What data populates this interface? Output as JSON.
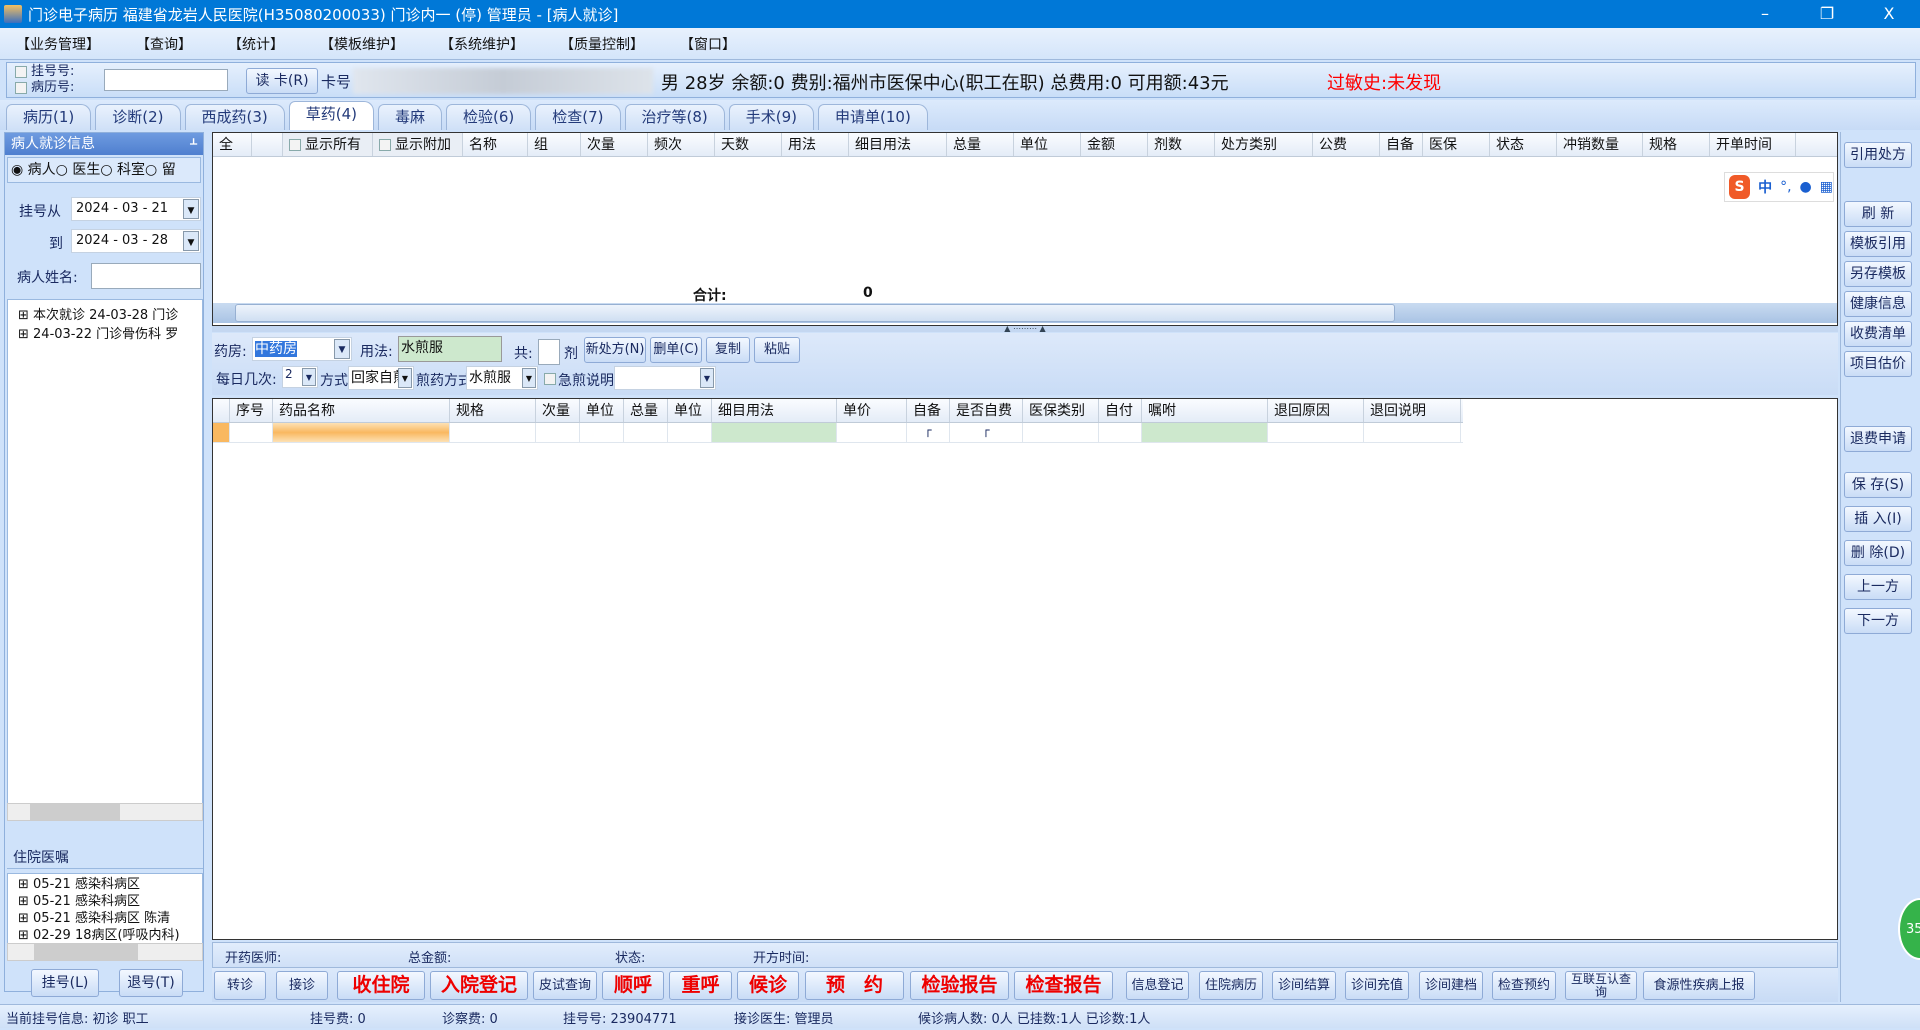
{
  "window": {
    "title": "门诊电子病历  福建省龙岩人民医院(H35080200033) 门诊内一 (停)   管理员 - [病人就诊]",
    "minimize": "–",
    "restore": "❐",
    "close": "X"
  },
  "menu": [
    "【业务管理】",
    "【查询】",
    "【统计】",
    "【模板维护】",
    "【系统维护】",
    "【质量控制】",
    "【窗口】"
  ],
  "patient": {
    "reg_no_label": "挂号号:",
    "record_no_label": "病历号:",
    "read_card": "读 卡(R)",
    "card_label": "卡号",
    "summary": "男  28岁  余额:0  费别:福州市医保中心(职工在职)  总费用:0  可用额:43元",
    "allergy": "过敏史:未发现"
  },
  "tabs": [
    {
      "label": "病历(1)"
    },
    {
      "label": "诊断(2)"
    },
    {
      "label": "西成药(3)"
    },
    {
      "label": "草药(4)",
      "active": true
    },
    {
      "label": "毒麻"
    },
    {
      "label": "检验(6)"
    },
    {
      "label": "检查(7)"
    },
    {
      "label": "治疗等(8)"
    },
    {
      "label": "手术(9)"
    },
    {
      "label": "申请单(10)"
    }
  ],
  "left": {
    "title": "病人就诊信息",
    "pin": "ᚆ",
    "radios": [
      "病人",
      "医生",
      "科室",
      "留"
    ],
    "from_label": "挂号从",
    "from": "2024 - 03 - 21",
    "to_label": "到",
    "to": "2024 - 03 - 28",
    "name_label": "病人姓名:",
    "visits": [
      "本次就诊  24-03-28  门诊",
      "24-03-22  门诊骨伤科  罗"
    ],
    "inpatient_title": "住院医嘱",
    "inpatient": [
      "05-21  感染科病区",
      "05-21  感染科病区",
      "05-21  感染科病区  陈清",
      "02-29  18病区(呼吸内科)"
    ],
    "register": "挂号(L)",
    "unregister": "退号(T)"
  },
  "top_grid": {
    "all": "全",
    "show_all": "显示所有",
    "show_extra": "显示附加",
    "columns": [
      "名称",
      "组",
      "次量",
      "频次",
      "天数",
      "用法",
      "细目用法",
      "总量",
      "单位",
      "金额",
      "剂数",
      "处方类别",
      "公费",
      "自备",
      "医保",
      "状态",
      "冲销数量",
      "规格",
      "开单时间"
    ],
    "total_label": "合计:",
    "total_value": "0"
  },
  "form": {
    "pharmacy_label": "药房:",
    "pharmacy": "中药房",
    "usage_label": "用法:",
    "usage": "水煎服",
    "total_label": "共:",
    "dose_unit": "剂",
    "new_rx": "新处方(N)",
    "delete_rx": "删单(C)",
    "copy": "复制",
    "paste": "粘贴",
    "daily_label": "每日几次:",
    "daily": "2",
    "method_label": "方式:",
    "method": "回家自煎",
    "decoct_label": "煎药方式:",
    "decoct": "水煎服",
    "urgent_label": "急煎",
    "note_label": "说明:"
  },
  "bottom_grid": {
    "columns": [
      "序号",
      "药品名称",
      "规格",
      "次量",
      "单位",
      "总量",
      "单位",
      "细目用法",
      "单价",
      "自备",
      "是否自费",
      "医保类别",
      "自付",
      "嘱咐",
      "退回原因",
      "退回说明"
    ]
  },
  "footer_info": {
    "doctor": "开药医师:",
    "amount": "总金额:",
    "status": "状态:",
    "time": "开方时间:"
  },
  "actions": [
    {
      "label": "转诊"
    },
    {
      "label": "接诊"
    },
    {
      "label": "收住院",
      "red": true
    },
    {
      "label": "入院登记",
      "red": true
    },
    {
      "label": "皮试查询"
    },
    {
      "label": "顺呼",
      "red": true
    },
    {
      "label": "重呼",
      "red": true
    },
    {
      "label": "候诊",
      "red": true
    },
    {
      "label": "预　约",
      "red": true
    },
    {
      "label": "检验报告",
      "red": true
    },
    {
      "label": "检查报告",
      "red": true
    },
    {
      "label": "信息登记"
    },
    {
      "label": "住院病历"
    },
    {
      "label": "诊间结算"
    },
    {
      "label": "诊间充值"
    },
    {
      "label": "诊间建档"
    },
    {
      "label": "检查预约"
    },
    {
      "label": "互联互认查询"
    },
    {
      "label": "食源性疾病上报"
    }
  ],
  "right_buttons": [
    "引用处方",
    "刷 新",
    "模板引用",
    "另存模板",
    "健康信息",
    "收费清单",
    "项目估价",
    "退费申请",
    "保 存(S)",
    "插 入(I)",
    "删 除(D)",
    "上一方",
    "下一方"
  ],
  "ime": {
    "logo": "S",
    "lang": "中",
    "punct": "°,"
  },
  "badge": "35",
  "status": {
    "current": "当前挂号信息:   初诊 职工",
    "reg_fee": "挂号费:   0",
    "exam_fee": "诊察费:  0",
    "reg_no": "挂号号:    23904771",
    "doctor": "接诊医生:    管理员",
    "waiting": "候诊病人数: 0人  已挂数:1人  已诊数:1人"
  },
  "colors": {
    "titlebar": "#0078d7",
    "alert": "#ff0000",
    "accent_green": "#cde8cd",
    "accent_orange": "#f9b860"
  }
}
